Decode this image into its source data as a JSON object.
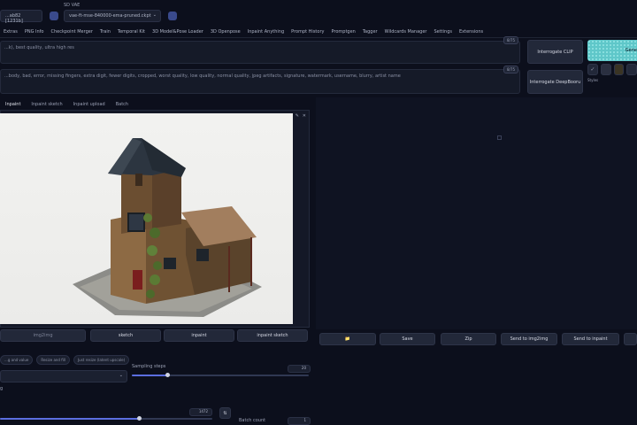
{
  "header": {
    "checkpoint_value": "...ab82 [1231b]",
    "sd_vae_label": "SD VAE",
    "sd_vae_value": "vae-ft-mse-840000-ema-pruned.ckpt"
  },
  "tabs": [
    "Extras",
    "PNG Info",
    "Checkpoint Merger",
    "Train",
    "Temporal Kit",
    "3D Model&Pose Loader",
    "3D Openpose",
    "Inpaint Anything",
    "Prompt History",
    "Promptgen",
    "Tagger",
    "Wildcards Manager",
    "Settings",
    "Extensions"
  ],
  "prompt": {
    "positive": "...k), best quality, ultra high res",
    "negative": "...body, bad, error, missing fingers, extra digit, fewer digits, cropped, worst quality, low quality, normal quality, jpeg artifacts, signature, watermark, username, blurry, artist name",
    "token_badge_1": "8/75",
    "token_badge_2": "8/75"
  },
  "interrogate": {
    "clip": "Interrogate CLIP",
    "deepbooru": "Interrogate DeepBooru",
    "generate": "Gene",
    "styles_label": "Styles"
  },
  "img2img_tabs": [
    "Inpaint",
    "Inpaint sketch",
    "Inpaint upload",
    "Batch"
  ],
  "copy_buttons": [
    "img2img",
    "sketch",
    "inpaint",
    "inpaint sketch"
  ],
  "output_buttons": [
    "📁",
    "Save",
    "Zip",
    "Send to img2img",
    "Send to inpaint"
  ],
  "chips": [
    "...g and value",
    "Resize and fill",
    "Just resize (latent upscale)"
  ],
  "sampling_steps_label": "Sampling steps",
  "sampling_steps_value": "20",
  "sampling_steps_fraction": 0.2,
  "width_value": "1472",
  "swap_label": "⇅",
  "batch_count_label": "Batch count",
  "batch_count_value": "1",
  "left_partial_label": "g"
}
